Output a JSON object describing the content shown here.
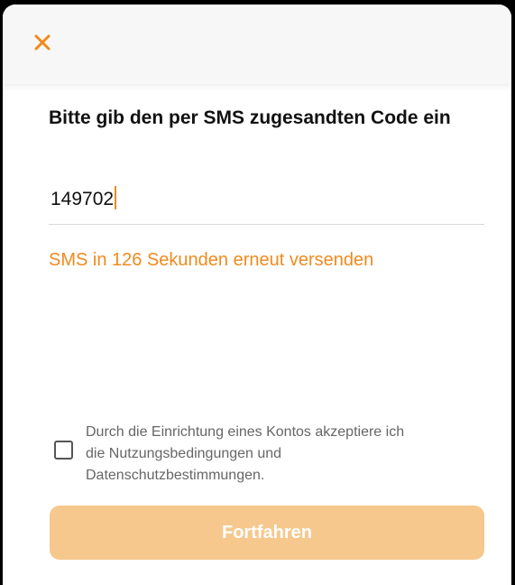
{
  "header": {
    "close_icon": "close-icon"
  },
  "verification": {
    "title": "Bitte gib den per SMS zugesandten Code ein",
    "code_value": "149702",
    "resend_text": "SMS in 126 Sekunden erneut versenden"
  },
  "consent": {
    "checked": false,
    "text": "Durch die Einrichtung eines Kontos akzeptiere ich\ndie Nutzungsbedingungen und\nDatenschutzbestimmungen."
  },
  "actions": {
    "continue_label": "Fortfahren",
    "enabled": false
  },
  "colors": {
    "accent": "#f08a1e",
    "button_disabled": "#f6c88e",
    "header_background": "#f7f7f7",
    "text": "#111111",
    "muted_text": "#666666"
  }
}
